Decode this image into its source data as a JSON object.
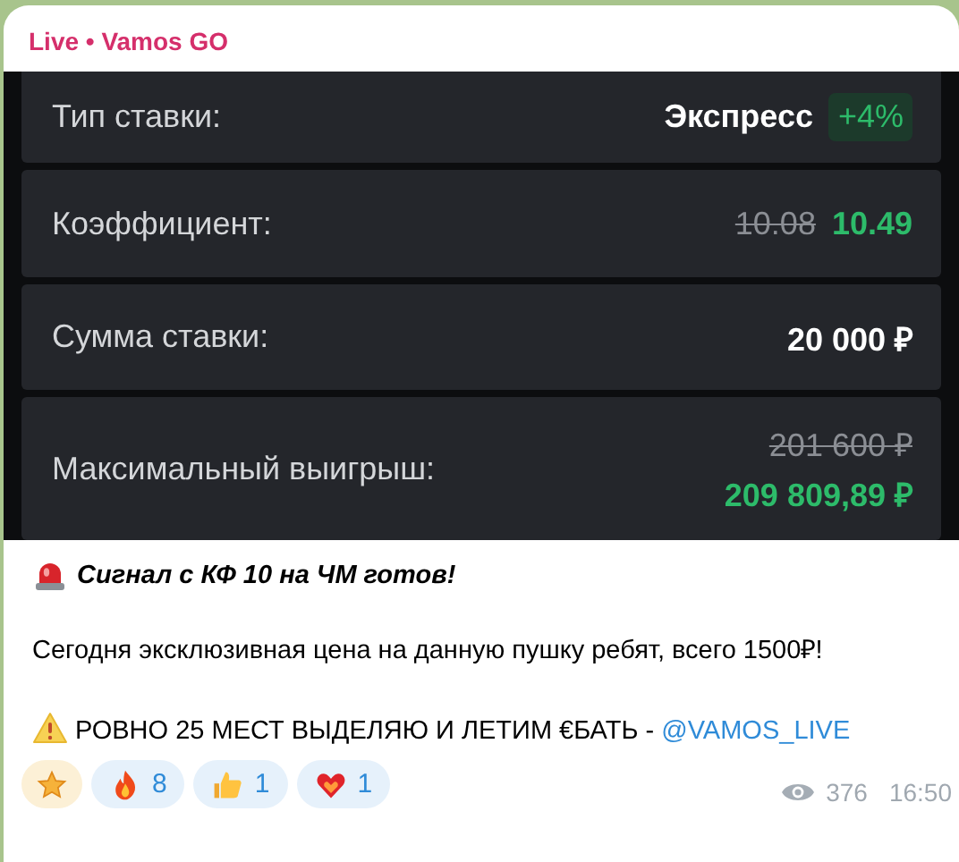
{
  "channel": {
    "name": "Live • Vamos GO"
  },
  "bet_slip": {
    "rows": [
      {
        "kind": "badge",
        "label": "Тип ставки:",
        "value": "Экспресс",
        "badge": "+4%"
      },
      {
        "kind": "inline",
        "label": "Коэффициент:",
        "old": "10.08",
        "value": "10.49"
      },
      {
        "kind": "plain",
        "label": "Сумма ставки:",
        "value": "20 000 ₽"
      },
      {
        "kind": "stacked",
        "label": "Максимальный выигрыш:",
        "old": "201 600 ₽",
        "value": "209 809,89 ₽"
      }
    ]
  },
  "message": {
    "headline": "Сигнал с КФ 10 на ЧМ готов!",
    "paragraph": "Сегодня эксклюзивная цена на данную пушку ребят, всего 1500₽!",
    "warning": "РОВНО 25 МЕСТ ВЫДЕЛЯЮ И ЛЕТИМ €БАТЬ - ",
    "link": "@VAMOS_LIVE"
  },
  "reactions": [
    {
      "kind": "star"
    },
    {
      "kind": "fire",
      "count": "8"
    },
    {
      "kind": "thumbs",
      "count": "1"
    },
    {
      "kind": "heart",
      "count": "1"
    }
  ],
  "views": "376",
  "time": "16:50"
}
